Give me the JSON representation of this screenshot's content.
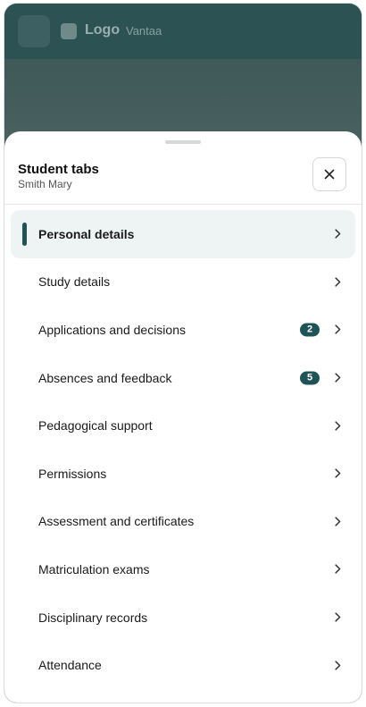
{
  "header": {
    "logo_text": "Logo",
    "city": "Vantaa"
  },
  "sheet": {
    "title": "Student tabs",
    "subtitle": "Smith Mary",
    "close_icon": "close-icon"
  },
  "colors": {
    "accent": "#1f5457",
    "active_bg": "#eef4f4",
    "topbar": "#2d5254"
  },
  "menu": [
    {
      "label": "Personal details",
      "active": true,
      "badge": null
    },
    {
      "label": "Study details",
      "active": false,
      "badge": null
    },
    {
      "label": "Applications and decisions",
      "active": false,
      "badge": "2"
    },
    {
      "label": "Absences and feedback",
      "active": false,
      "badge": "5"
    },
    {
      "label": "Pedagogical support",
      "active": false,
      "badge": null
    },
    {
      "label": "Permissions",
      "active": false,
      "badge": null
    },
    {
      "label": "Assessment and certificates",
      "active": false,
      "badge": null
    },
    {
      "label": "Matriculation exams",
      "active": false,
      "badge": null
    },
    {
      "label": "Disciplinary records",
      "active": false,
      "badge": null
    },
    {
      "label": "Attendance",
      "active": false,
      "badge": null
    }
  ]
}
